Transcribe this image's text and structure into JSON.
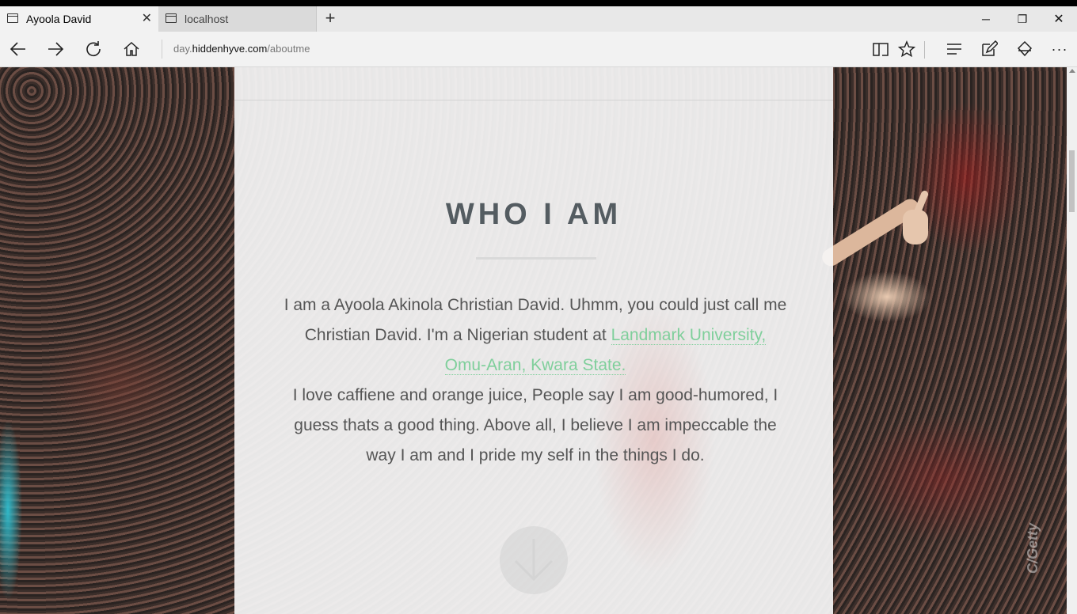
{
  "tabs": [
    {
      "title": "Ayoola David",
      "close": "✕"
    },
    {
      "title": "localhost"
    }
  ],
  "new_tab_label": "+",
  "window_controls": {
    "minimize": "─",
    "restore": "❐",
    "close": "✕"
  },
  "address": {
    "prefix": "day.",
    "host": "hiddenhyve.com",
    "path": "/aboutme"
  },
  "toolbar_icons": [
    "back-icon",
    "forward-icon",
    "refresh-icon",
    "home-icon",
    "reading-view-icon",
    "favorites-star-icon",
    "hub-icon",
    "web-note-icon",
    "share-icon",
    "more-icon"
  ],
  "page": {
    "heading": "WHO I AM",
    "bio_part1": "I am a Ayoola Akinola Christian David. Uhmm, you could just call me Christian David. I'm a Nigerian student at ",
    "bio_link": "Landmark University, Omu-Aran, Kwara State.",
    "bio_part2": "I love caffiene and orange juice, People say I am good-humored, I guess thats a good thing. Above all, I believe I am impeccable the way I am and I pride my self in the things I do.",
    "watermark": "C/Getty"
  },
  "colors": {
    "heading": "#545c61",
    "link": "#7fcf9b",
    "body_text": "#555555"
  }
}
